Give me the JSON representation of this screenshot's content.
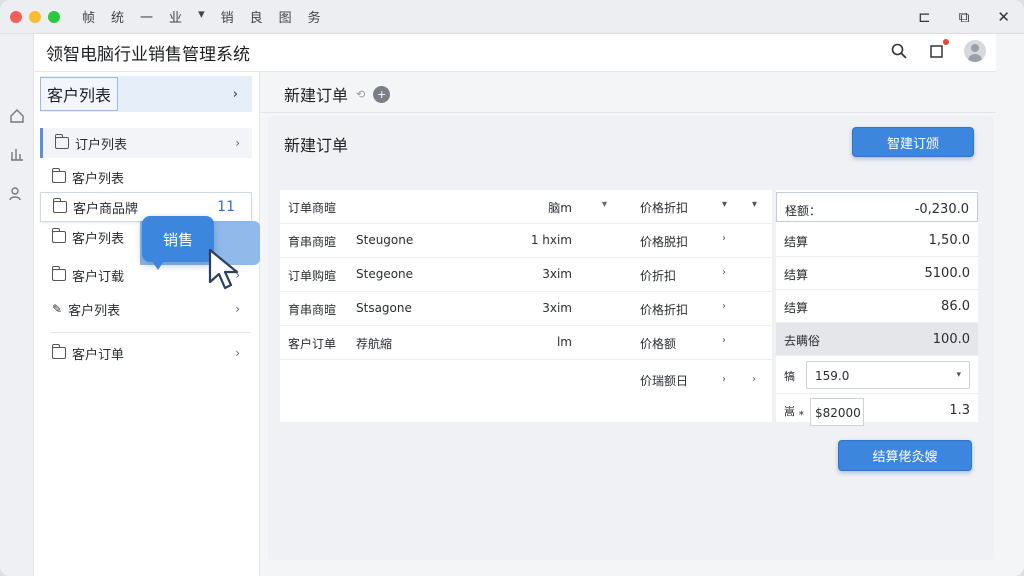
{
  "titlebar": {
    "menu": [
      "帧",
      "统",
      "一",
      "业",
      "▾",
      "销",
      "良",
      "图",
      "务"
    ],
    "controls": {
      "minimize": "⊏",
      "restore": "⧉",
      "close": "✕"
    }
  },
  "app": {
    "title": "领智电脑行业销售管理系统"
  },
  "sidebar": {
    "header": "客户列表",
    "items": [
      {
        "label": "订户列表",
        "chevron": "›"
      },
      {
        "label": "客户列表",
        "chevron": ""
      },
      {
        "label": "客户商品牌",
        "count": "11"
      },
      {
        "label": "客户列表",
        "chevron": ""
      },
      {
        "label": "客户订载",
        "chevron": "›"
      },
      {
        "label": "客户列表",
        "chevron": "›"
      },
      {
        "label": "客户订单",
        "chevron": "›"
      }
    ],
    "tooltip": "销售"
  },
  "main": {
    "breadcrumb": "新建订单",
    "breadcrumb_sep": "⟲",
    "breadcrumb_icon": "+",
    "section_title": "新建订单",
    "top_button": "智建订颁",
    "table": {
      "header": [
        "订单商暄",
        "",
        "脑m",
        "价格折扣"
      ],
      "rows": [
        [
          "育串商暄",
          "Steugone",
          "1 hxim",
          "价格脱扣"
        ],
        [
          "订单购暄",
          "Stegeone",
          "3xim",
          "价折扣"
        ],
        [
          "育串商暄",
          "Stsagone",
          "3xim",
          "价格折扣"
        ],
        [
          "客户订单",
          "荐航縮",
          "lm",
          "价格额"
        ],
        [
          "",
          "",
          "",
          "价瑞额日"
        ]
      ]
    },
    "summary": {
      "rows": [
        {
          "label": "柽额：",
          "value": "-0,230.0"
        },
        {
          "label": "结算",
          "value": "1,50.0"
        },
        {
          "label": "结算",
          "value": "5100.0"
        },
        {
          "label": "结算",
          "value": "86.0"
        },
        {
          "label": "去瞒俗",
          "value": "100.0"
        }
      ],
      "select_label": "犒",
      "select_value": "159.0",
      "input_label": "嵩 ⁎",
      "input_value": "$82000",
      "input_extra": "1.3"
    },
    "bottom_button": "结算佬灸嫂"
  },
  "colors": {
    "accent": "#3d86de",
    "background": "#f4f5f7"
  }
}
